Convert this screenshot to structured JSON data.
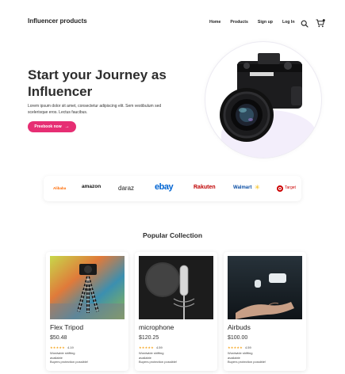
{
  "header": {
    "brand": "Influencer products",
    "nav": [
      "Home",
      "Products",
      "Sign up",
      "Log In"
    ]
  },
  "hero": {
    "title": "Start your Journey as Influencer",
    "description": "Lorem ipsum dolor sit amet, consectetur adipiscing elit. Sem vestibulum sed scelerisque eros. Lectus faucibus.",
    "cta_label": "Preebook now"
  },
  "brands": [
    "Alibaba",
    "amazon",
    "daraz",
    "ebay",
    "Rakuten",
    "Walmart",
    "Target"
  ],
  "collection": {
    "title": "Popular Collection",
    "items": [
      {
        "name": "Flex Tripod",
        "price": "$50.48",
        "rating": "4.19",
        "shipping": "Wordwide shifting",
        "availability": "available",
        "protection": "Buyers protection possible!"
      },
      {
        "name": "microphone",
        "price": "$120.25",
        "rating": "4.59",
        "shipping": "Wordwide shifting",
        "availability": "available",
        "protection": "Buyers protection possible!"
      },
      {
        "name": "Airbuds",
        "price": "$100.00",
        "rating": "4.59",
        "shipping": "Wordwide shifting",
        "availability": "available",
        "protection": "Buyers protection possible!"
      }
    ]
  },
  "colors": {
    "accent": "#e62e73",
    "heading": "#2d2d2d",
    "star": "#f5a623"
  }
}
